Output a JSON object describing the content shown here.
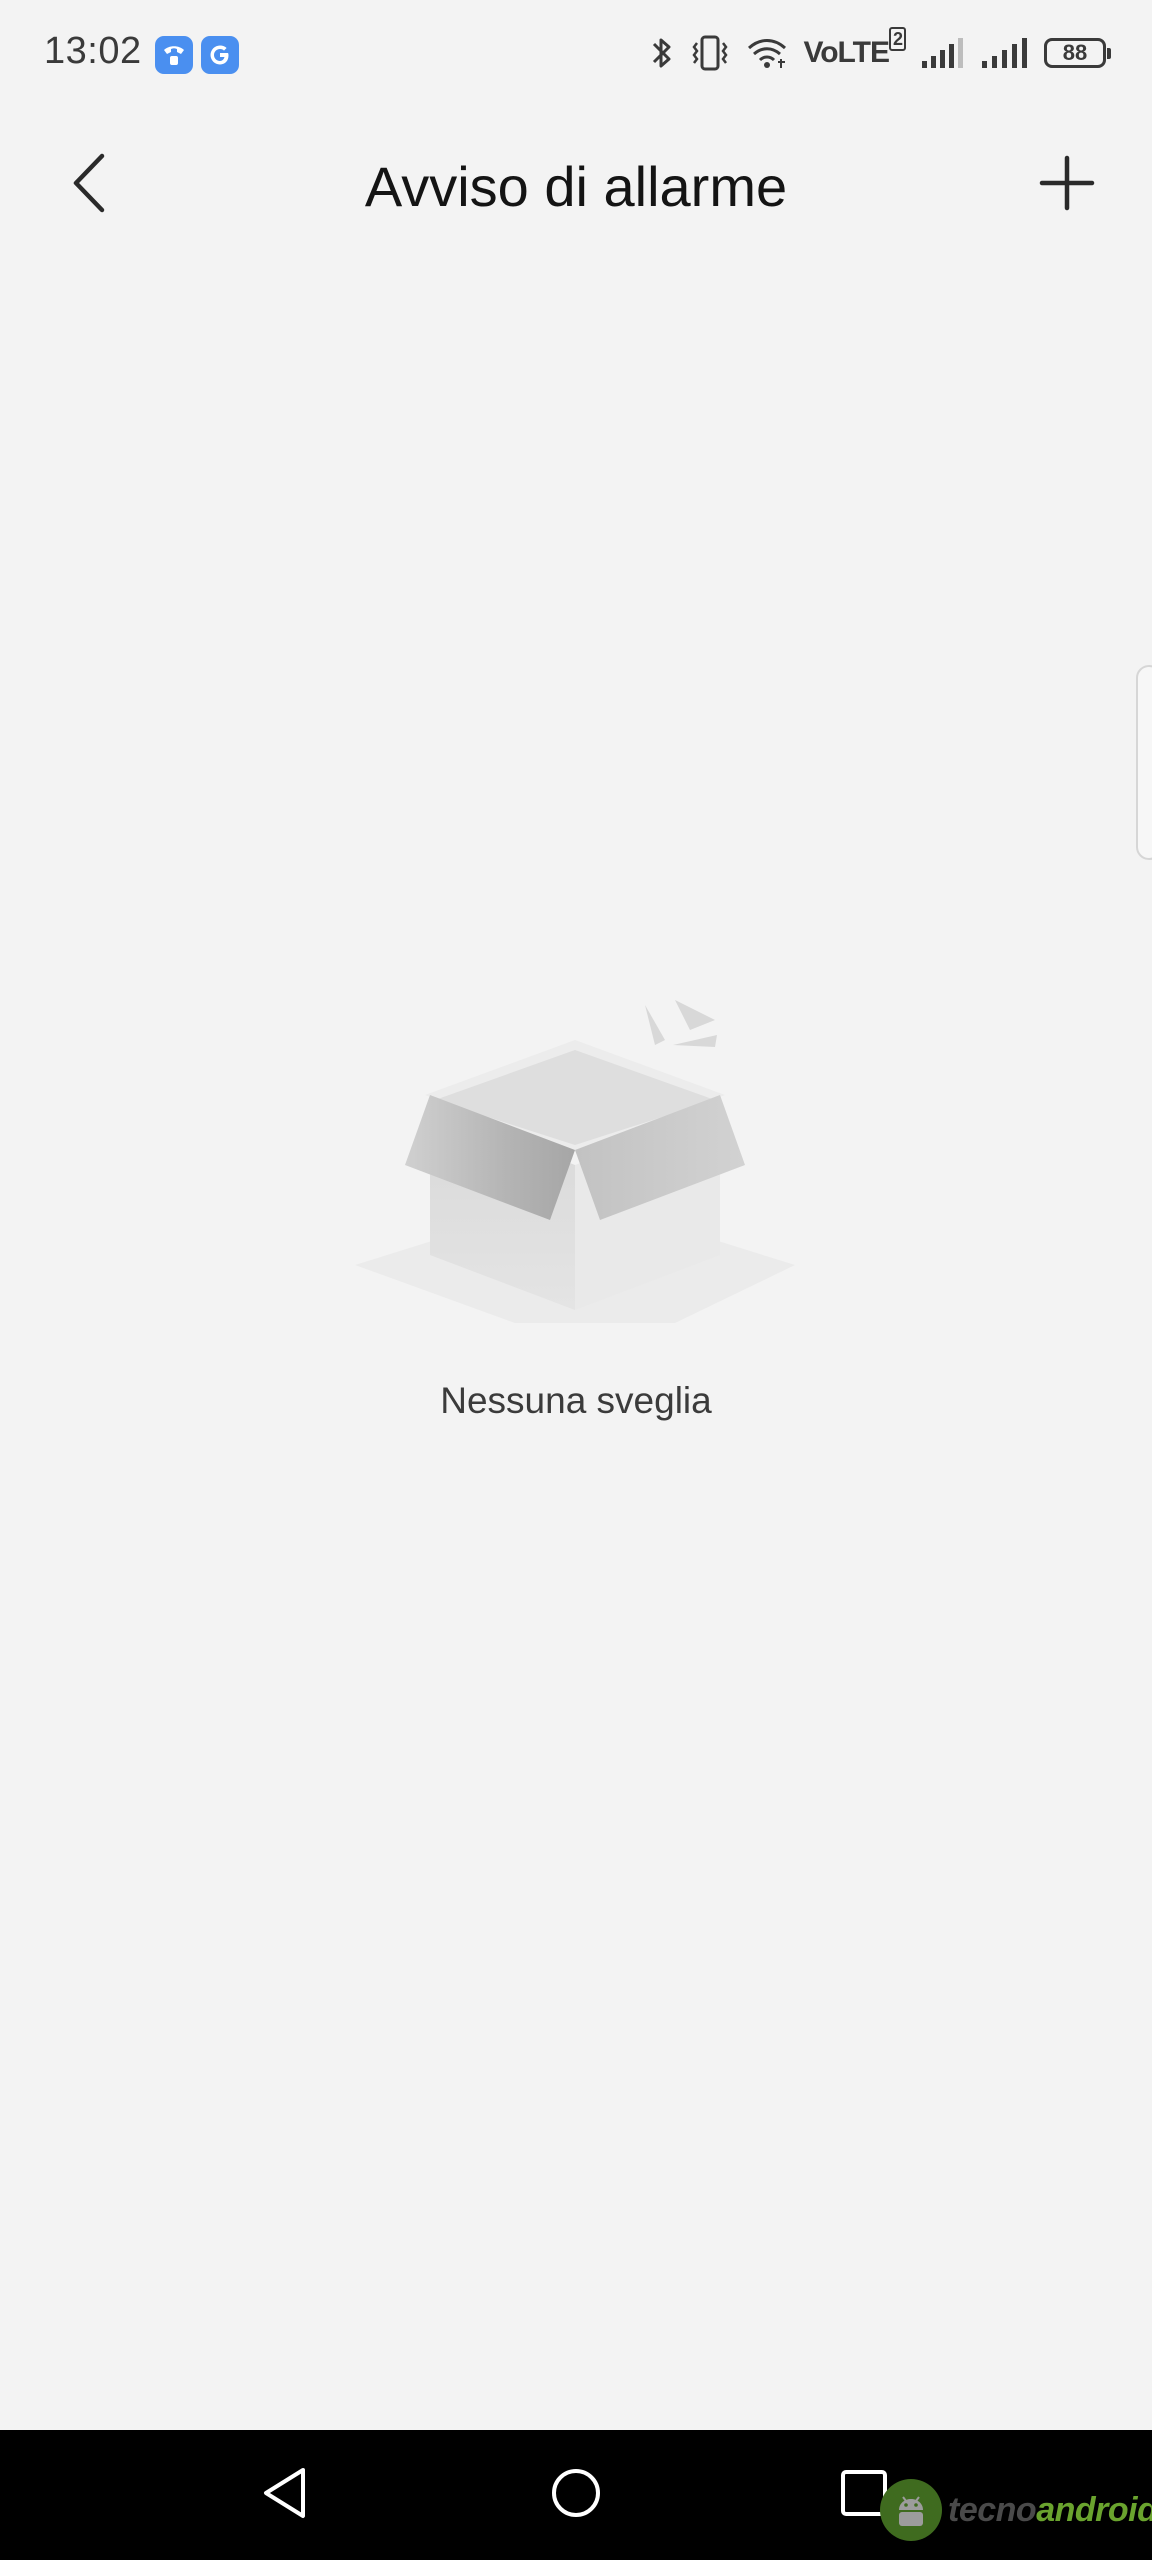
{
  "status_bar": {
    "time": "13:02",
    "network_label": "VoLTE",
    "network_sim": "2",
    "battery_level": "88",
    "icons": [
      "phone-call-app-icon",
      "google-app-icon",
      "bluetooth-icon",
      "vibrate-icon",
      "wifi-icon",
      "signal-strength-icon",
      "signal-strength-icon"
    ]
  },
  "header": {
    "title": "Avviso di allarme",
    "back_icon": "chevron-left-icon",
    "add_icon": "plus-icon"
  },
  "empty_state": {
    "message": "Nessuna sveglia",
    "illustration": "empty-box-icon"
  },
  "nav_bar": {
    "buttons": [
      "back-triangle-icon",
      "home-circle-icon",
      "recents-square-icon"
    ]
  },
  "watermark": {
    "text_part1": "tecno",
    "text_part2": "android"
  },
  "colors": {
    "background": "#f3f3f3",
    "nav_background": "#000000",
    "status_icon_blue": "#4a8ff0",
    "watermark_green": "#6aa32e"
  }
}
